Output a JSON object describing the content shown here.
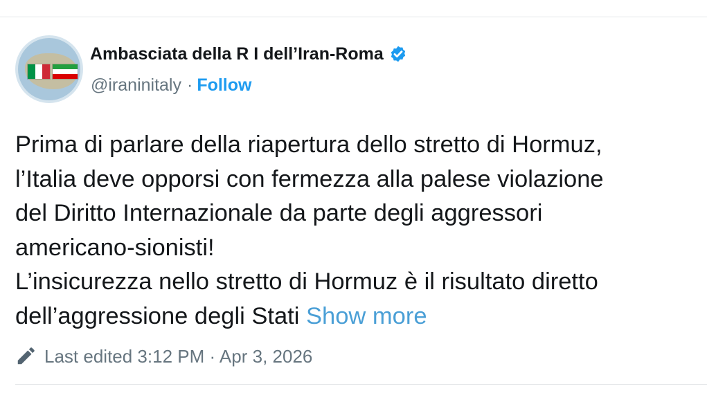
{
  "account": {
    "display_name": "Ambasciata della R I dell’Iran-Roma",
    "handle": "@iraninitaly",
    "separator": "·",
    "follow_label": "Follow",
    "verified_icon": "verified-badge-icon",
    "avatar_icon": "embassy-flags-avatar"
  },
  "tweet": {
    "lines": [
      "Prima di parlare della riapertura dello stretto di Hormuz,",
      "l’Italia deve opporsi con fermezza alla palese violazione",
      "del Diritto Internazionale da parte degli aggressori",
      "americano-sionisti!",
      "L’insicurezza nello stretto di Hormuz è il risultato diretto",
      "dell’aggressione degli Stati"
    ],
    "show_more_label": "Show more"
  },
  "meta": {
    "edit_icon": "pencil-icon",
    "edited_text": "Last edited 3:12 PM · Apr 3, 2026"
  },
  "colors": {
    "accent": "#1d9bf0",
    "show_more": "#4a9fd6",
    "text": "#14171a",
    "secondary_text": "#66757f",
    "italy_green": "#009246",
    "italy_white": "#ffffff",
    "italy_red": "#ce2b37",
    "iran_green": "#239f40",
    "iran_white": "#ffffff",
    "iran_red": "#da0000"
  }
}
